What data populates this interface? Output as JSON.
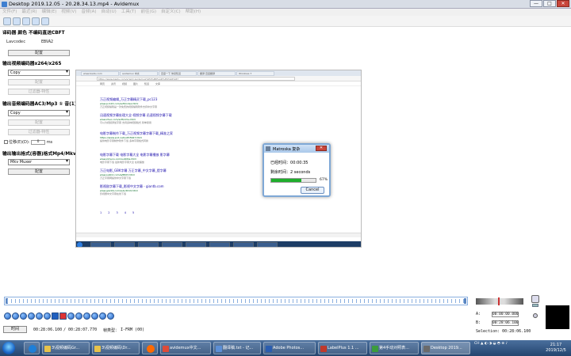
{
  "window": {
    "title": "Desktop 2019.12.05 - 20.28.34.13.mp4 - Avidemux",
    "min": "—",
    "max": "□",
    "close": "✕"
  },
  "menu": [
    "文件(F)",
    "最近(R)",
    "编辑(E)",
    "视频(V)",
    "音频(A)",
    "自动(U)",
    "工具(T)",
    "前往(G)",
    "自定义(C)",
    "帮助(H)"
  ],
  "toolbar_icons": [
    "open-icon",
    "info-icon",
    "save-icon",
    "help-icon",
    "props-icon"
  ],
  "left": {
    "decoder_title": "译码器 颜色 不编码直送CBFT",
    "lavcodec": "Lavcodec",
    "decoder_value": "EBVA2",
    "config": "配置",
    "video_title": "输出视频编码器x264/x265",
    "video_codec": "Copy",
    "filters": "过滤器-特性",
    "audio_title": "输出音频编码器AC3/Mp3 ① 音(1)",
    "audio_codec": "Copy",
    "shift_label": "位移(E)(D):",
    "shift_value": "0",
    "shift_unit": "ms",
    "format_title": "输出输出格式(容器)格式Mp4/Mkv",
    "format_value": "Mkv Muxer"
  },
  "preview": {
    "tabs": [
      "www.baidu.com",
      "avidemux 中文",
      "百度一下 你就知道",
      "翻译 百度翻译",
      "Windows 7"
    ],
    "url": "https://www.baidu.com/s?wd=avidemux%E4%B8%AD%E6%96%87",
    "nav": [
      "网页",
      "资讯",
      "视频",
      "图片",
      "知道",
      "文库"
    ],
    "results": [
      {
        "t": "万正视频编辑_万正字幕精灵下载_pc123",
        "u": "www.pc123.com/soft/index.html",
        "d": "万正视频编辑是一款免费的视频编辑软件支持中文字幕"
      },
      {
        "t": "迅速视频字幕处理大全-视频字幕 迅速视频字幕下载",
        "u": "www.zhuo.com/soft/zimu.html",
        "d": "可以为视频添加字幕 支持多种视频格式 简单易用"
      },
      {
        "t": "电影字幕制作下载_万正视频字幕字幕下载_精准之家",
        "u": "https://www.pcd.net/soft/5647.html",
        "d": "提供电影字幕制作软件下载 多种字幕格式转换"
      },
      {
        "t": "电影字幕下载 电影字幕大全 电影字幕播放 影字幕",
        "u": "www.zimuzu.com/subtitle.html",
        "d": "电影字幕下载 最新电影字幕大全 在线播放"
      },
      {
        "t": "万正电影_GBK字幕 万正字幕_中文字幕_提字幕",
        "u": "www.subhd.com/a/8823.html",
        "d": "万正字幕网提供中文字幕下载"
      },
      {
        "t": "影视剧字幕下载_影视中文字幕 - giantb.com",
        "u": "www.giantb.com/sub/2019.html",
        "d": "影视剧中文字幕在线下载"
      }
    ],
    "pages": [
      "1",
      "2",
      "3",
      "4",
      "5"
    ]
  },
  "dialog": {
    "title": "Matroska 复杂",
    "elapsed_label": "已经时间：",
    "elapsed": "00:00:35",
    "remain_label": "剩余时间：",
    "remain": "2 seconds",
    "progress": 0.67,
    "percent": "67%",
    "cancel": "Cancel"
  },
  "player": {
    "time_btn": "时间",
    "current": "00:28:06.100",
    "total": "/ 00:28:07.770",
    "frame_label": "帧类型：",
    "frame": "I-FRM (00)",
    "a_label": "A:",
    "a_val": "00:00:00.000",
    "b_label": "B:",
    "b_val": "00:28:06.100",
    "selection": "Selection: 00:28:06.100"
  },
  "taskbar": {
    "items": [
      {
        "label": "",
        "color": "#1e7fd8",
        "icon": "ie-icon"
      },
      {
        "label": "3\\视频编码Gr...",
        "color": "#e6c24b"
      },
      {
        "label": "3\\视频编码\\Dr...",
        "color": "#e6c24b"
      },
      {
        "label": "",
        "color": "#ff6a00",
        "icon": "media-icon"
      },
      {
        "label": "avidemux中文...",
        "color": "#dd4b39"
      },
      {
        "label": "翻译稿.txt - 记...",
        "color": "#5c8fd6"
      },
      {
        "label": "Adobe Photos...",
        "color": "#2a5db0"
      },
      {
        "label": "LabelPlus 1.1 ...",
        "color": "#c0392b"
      },
      {
        "label": "第4手动对照表...",
        "color": "#3c9c3c"
      },
      {
        "label": "Desktop 2019...",
        "color": "#6a6a6a"
      }
    ],
    "tray": "CH ▲ ◐ ◑ ◒ ◓ ⊕ ♪",
    "time": "21:17",
    "date": "2019/12/5"
  }
}
